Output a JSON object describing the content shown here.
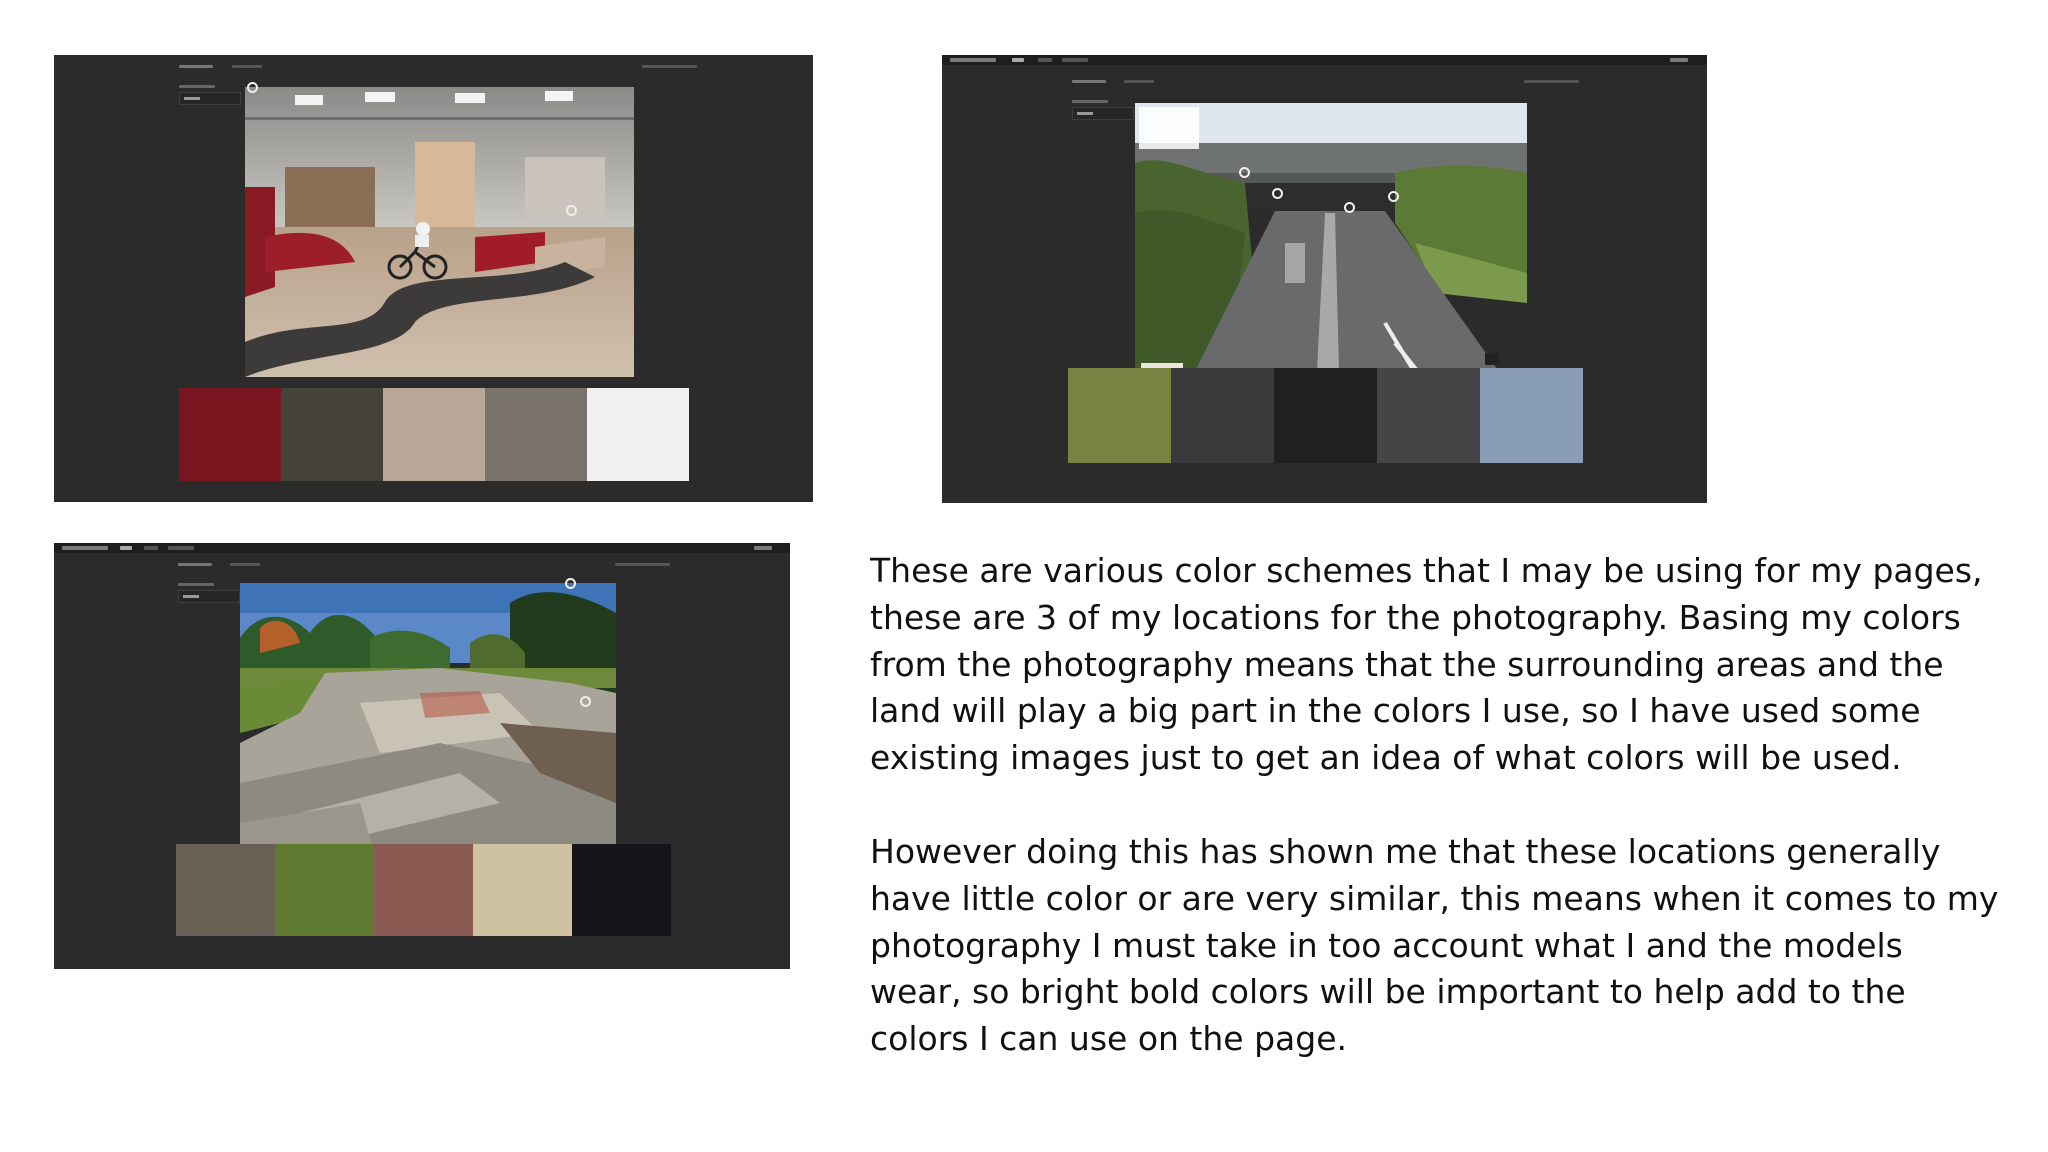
{
  "palettes": [
    {
      "location": "indoor-skatepark",
      "swatches": [
        "#7a1620",
        "#45423a",
        "#b8a696",
        "#7a736c",
        "#f0f0f2"
      ]
    },
    {
      "location": "road-underpass",
      "swatches": [
        "#7a8242",
        "#3b383b",
        "#211f21",
        "#464446",
        "#8a9db8"
      ]
    },
    {
      "location": "outdoor-skatepark",
      "swatches": [
        "#6b6056",
        "#5f7a30",
        "#8a5a52",
        "#cfc2a0",
        "#15141a"
      ]
    }
  ],
  "description": {
    "paragraph_1": "These are various color schemes that I may be using for my pages, these are 3 of my locations for the photography. Basing my colors from the photography means that the surrounding areas and the land will play a big part in the colors I use, so I have used some existing images just to get an idea of what colors will be used.",
    "paragraph_2": "However doing this has shown me that these locations generally have little color or are very similar, this means when it comes to my photography I must take in too account what I and the models wear, so bright bold colors will be important to help add to the colors I can use on the page."
  }
}
